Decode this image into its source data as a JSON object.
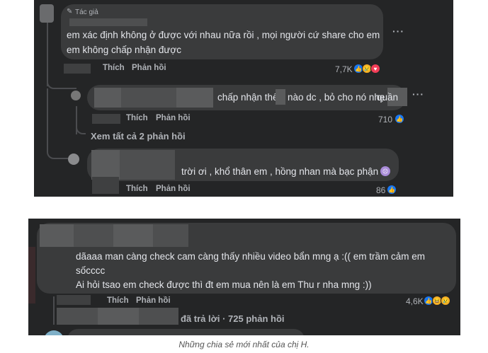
{
  "thread1": {
    "comment1": {
      "author_badge": "Tác giả",
      "lines": [
        "em xác định không ở được với nhau nữa rồi , mọi người cứ share cho em",
        "em không chấp nhận được"
      ],
      "like_label": "Thích",
      "reply_label": "Phản hồi",
      "reaction_count": "7,7K",
      "reactions": [
        "like-icon",
        "sad-icon",
        "heart-icon"
      ]
    },
    "reply1": {
      "text_part1": "chấp nhận thế",
      "text_part2": "nào dc , bỏ cho nó nhẹ",
      "text_part3": "quần",
      "like_label": "Thích",
      "reply_label": "Phản hồi",
      "reaction_count": "710",
      "reactions": [
        "like-icon"
      ]
    },
    "see_all_replies": "Xem tất cả 2 phản hồi",
    "reply2": {
      "text": "trời ơi , khổ thân em , hồng nhan mà bạc phận",
      "like_label": "Thích",
      "reply_label": "Phản hồi",
      "reaction_count": "86",
      "reactions": [
        "like-icon"
      ]
    }
  },
  "thread2": {
    "comment": {
      "lines": [
        "dãaaa man càng check cam càng thấy nhiều video bẩn mng ạ :(( em trầm cảm em",
        "sốcccc",
        "Ai hỏi tsao em check được thì đt em mua nên là em Thu r nha mng :))"
      ],
      "like_label": "Thích",
      "reply_label": "Phản hồi",
      "reaction_count": "4,6K",
      "reactions": [
        "like-icon",
        "haha-icon",
        "sad-icon"
      ]
    },
    "replies_summary": "đã trả lời · 725 phản hồi"
  },
  "caption": "Những chia sẻ mới nhất của chị H."
}
